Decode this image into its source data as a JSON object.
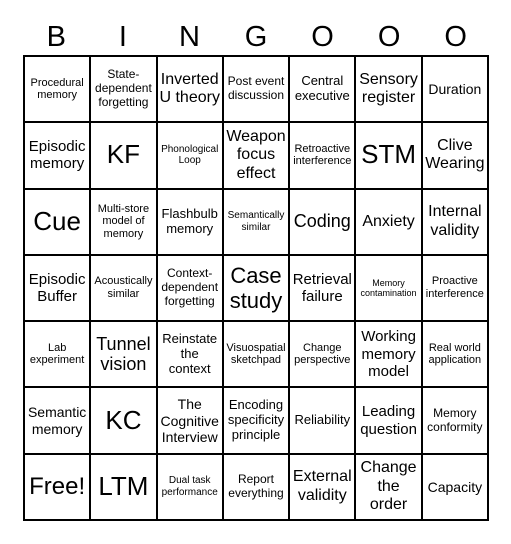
{
  "header": [
    "B",
    "I",
    "N",
    "G",
    "O",
    "O",
    "O"
  ],
  "cells": [
    [
      "Procedural memory",
      "State-dependent forgetting",
      "Inverted U theory",
      "Post event discussion",
      "Central executive",
      "Sensory register",
      "Duration"
    ],
    [
      "Episodic memory",
      "KF",
      "Phonological Loop",
      "Weapon focus effect",
      "Retroactive interference",
      "STM",
      "Clive Wearing"
    ],
    [
      "Cue",
      "Multi-store model of memory",
      "Flashbulb memory",
      "Semantically similar",
      "Coding",
      "Anxiety",
      "Internal validity"
    ],
    [
      "Episodic Buffer",
      "Acoustically similar",
      "Context-dependent forgetting",
      "Case study",
      "Retrieval failure",
      "Memory contamination",
      "Proactive interference"
    ],
    [
      "Lab experiment",
      "Tunnel vision",
      "Reinstate the context",
      "Visuospatial sketchpad",
      "Change perspective",
      "Working memory model",
      "Real world application"
    ],
    [
      "Semantic memory",
      "KC",
      "The Cognitive Interview",
      "Encoding specificity principle",
      "Reliability",
      "Leading question",
      "Memory conformity"
    ],
    [
      "Free!",
      "LTM",
      "Dual task performance",
      "Report everything",
      "External validity",
      "Change the order",
      "Capacity"
    ]
  ]
}
